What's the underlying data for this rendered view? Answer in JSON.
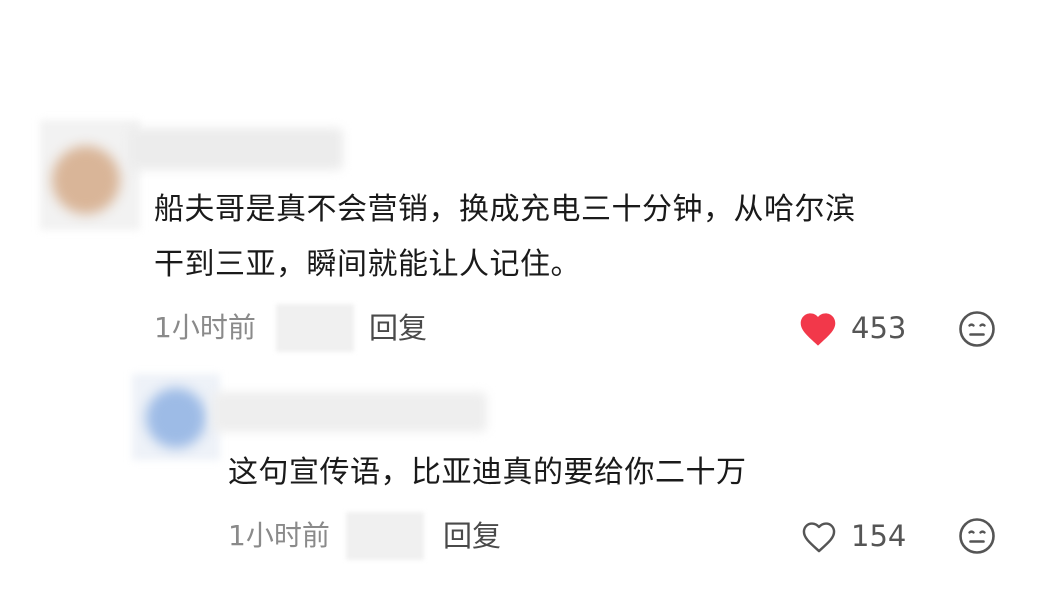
{
  "comments": [
    {
      "text_line1": "船夫哥是真不会营销，换成充电三十分钟，从哈尔滨",
      "text_line2": "干到三亚，瞬间就能让人记住。",
      "time": "1小时前",
      "reply_label": "回复",
      "likes": "453",
      "liked": true,
      "like_icon": "heart-filled-icon",
      "like_color": "#f2384a",
      "reaction_icon": "neutral-face-icon"
    },
    {
      "text": "这句宣传语，比亚迪真的要给你二十万",
      "time": "1小时前",
      "reply_label": "回复",
      "likes": "154",
      "liked": false,
      "like_icon": "heart-outline-icon",
      "reaction_icon": "neutral-face-icon"
    }
  ]
}
